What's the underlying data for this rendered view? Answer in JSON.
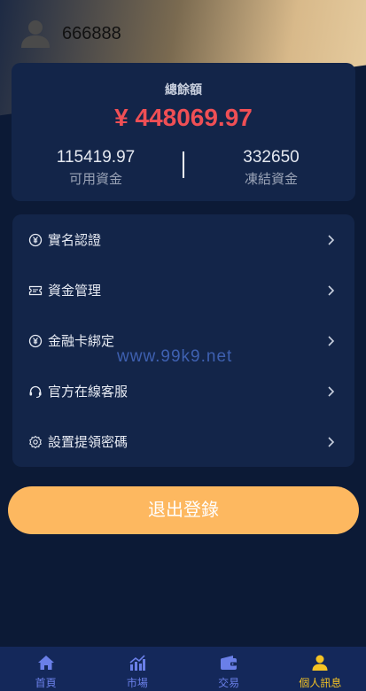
{
  "header": {
    "username": "666888"
  },
  "balance": {
    "total_label": "總餘額",
    "total_amount": "¥ 448069.97",
    "available_value": "115419.97",
    "available_label": "可用資金",
    "frozen_value": "332650",
    "frozen_label": "凍結資金"
  },
  "menu": {
    "items": [
      {
        "label": "實名認證",
        "icon": "yen-circle-icon"
      },
      {
        "label": "資金管理",
        "icon": "ticket-icon"
      },
      {
        "label": "金融卡綁定",
        "icon": "yen-circle-icon"
      },
      {
        "label": "官方在線客服",
        "icon": "headset-icon"
      },
      {
        "label": "設置提領密碼",
        "icon": "gear-icon"
      }
    ]
  },
  "watermark": "www.99k9.net",
  "logout_label": "退出登錄",
  "nav": {
    "items": [
      {
        "label": "首頁",
        "icon": "home-icon"
      },
      {
        "label": "市場",
        "icon": "chart-icon"
      },
      {
        "label": "交易",
        "icon": "wallet-icon"
      },
      {
        "label": "個人訊息",
        "icon": "user-icon"
      }
    ],
    "active_index": 3
  },
  "colors": {
    "accent": "#fdb860",
    "amount": "#ef4f55",
    "nav_active": "#f5c324",
    "nav_inactive": "#6a7fe8"
  }
}
